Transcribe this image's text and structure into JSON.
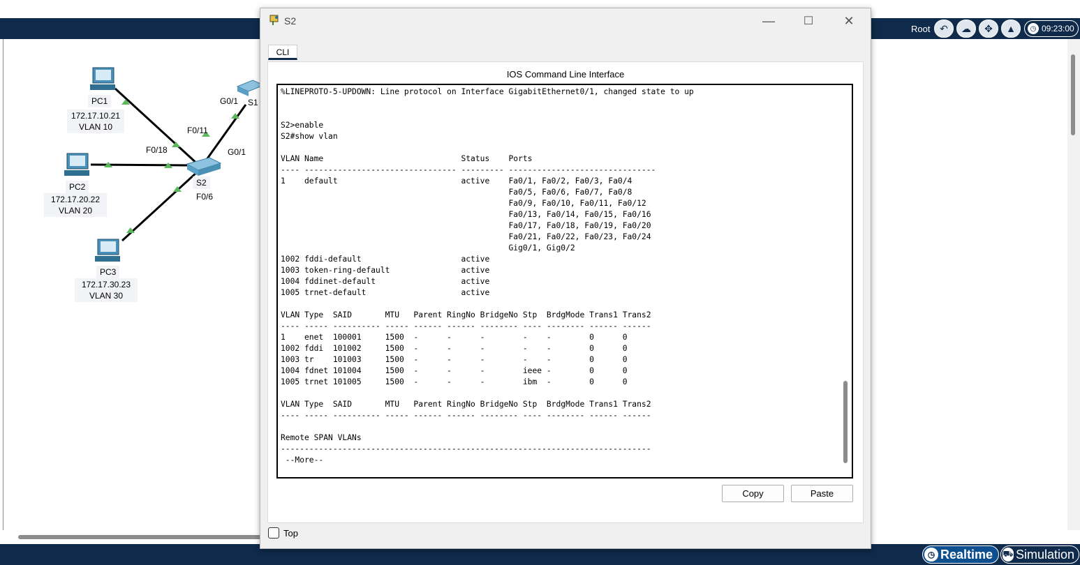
{
  "toolbar": {
    "root_label": "Root",
    "clock": "09:23:00",
    "icons": [
      "back-arrow-icon",
      "cloud-icon",
      "navigation-icon",
      "image-icon",
      "clock-icon"
    ]
  },
  "modes": {
    "realtime": "Realtime",
    "simulation": "Simulation"
  },
  "topology": {
    "pc1": {
      "name": "PC1",
      "ip": "172.17.10.21",
      "vlan": "VLAN 10"
    },
    "pc2": {
      "name": "PC2",
      "ip": "172.17.20.22",
      "vlan": "VLAN 20"
    },
    "pc3": {
      "name": "PC3",
      "ip": "172.17.30.23",
      "vlan": "VLAN 30"
    },
    "s2": {
      "name": "S2"
    },
    "s1": {
      "name": "S1"
    },
    "ports": {
      "g01_top": "G0/1",
      "f011": "F0/11",
      "f018": "F0/18",
      "g01_s2": "G0/1",
      "f06": "F0/6"
    },
    "colors": {
      "link": "#000000",
      "link_up": "#5cb85c",
      "background": "#ffffff"
    }
  },
  "window": {
    "title": "S2",
    "tab": "CLI",
    "panel_title": "IOS Command Line Interface",
    "terminal_text": "                               ...   ,   ,      ...         .       \n%LINEPROTO-5-UPDOWN: Line protocol on Interface GigabitEthernet0/1, changed state to up\n\n\nS2>enable\nS2#show vlan\n\nVLAN Name                             Status    Ports\n---- -------------------------------- --------- -------------------------------\n1    default                          active    Fa0/1, Fa0/2, Fa0/3, Fa0/4\n                                                Fa0/5, Fa0/6, Fa0/7, Fa0/8\n                                                Fa0/9, Fa0/10, Fa0/11, Fa0/12\n                                                Fa0/13, Fa0/14, Fa0/15, Fa0/16\n                                                Fa0/17, Fa0/18, Fa0/19, Fa0/20\n                                                Fa0/21, Fa0/22, Fa0/23, Fa0/24\n                                                Gig0/1, Gig0/2\n1002 fddi-default                     active    \n1003 token-ring-default               active    \n1004 fddinet-default                  active    \n1005 trnet-default                    active    \n\nVLAN Type  SAID       MTU   Parent RingNo BridgeNo Stp  BrdgMode Trans1 Trans2\n---- ----- ---------- ----- ------ ------ -------- ---- -------- ------ ------\n1    enet  100001     1500  -      -      -        -    -        0      0\n1002 fddi  101002     1500  -      -      -        -    -        0      0\n1003 tr    101003     1500  -      -      -        -    -        0      0\n1004 fdnet 101004     1500  -      -      -        ieee -        0      0\n1005 trnet 101005     1500  -      -      -        ibm  -        0      0\n\nVLAN Type  SAID       MTU   Parent RingNo BridgeNo Stp  BrdgMode Trans1 Trans2\n---- ----- ---------- ----- ------ ------ -------- ---- -------- ------ ------\n\nRemote SPAN VLANs\n------------------------------------------------------------------------------\n --More--",
    "copy_label": "Copy",
    "paste_label": "Paste",
    "top_label": "Top",
    "controls": {
      "minimize": "—",
      "maximize": "☐",
      "close": "✕"
    }
  }
}
